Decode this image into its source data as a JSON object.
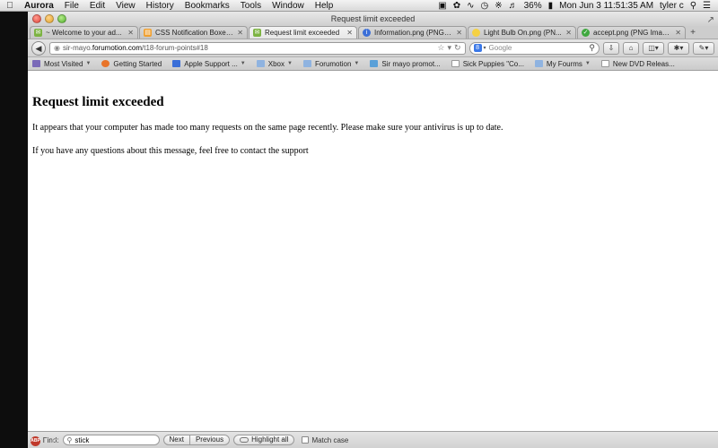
{
  "menubar": {
    "apple": "",
    "items": [
      "Aurora",
      "File",
      "Edit",
      "View",
      "History",
      "Bookmarks",
      "Tools",
      "Window",
      "Help"
    ],
    "battery": "36%",
    "clock": "Mon Jun 3  11:51:35 AM",
    "user": "tyler c"
  },
  "window": {
    "title": "Request limit exceeded"
  },
  "tabs": [
    {
      "label": "~ Welcome to your ad...",
      "icon": "speech-bubble-icon",
      "color": "#7cb342",
      "active": false
    },
    {
      "label": "CSS Notification Boxes ...",
      "icon": "folder-icon",
      "color": "#f0a030",
      "active": false
    },
    {
      "label": "Request limit exceeded",
      "icon": "speech-bubble-icon",
      "color": "#7cb342",
      "active": true
    },
    {
      "label": "Information.png (PNG I...",
      "icon": "info-icon",
      "color": "#3b6fd8",
      "active": false
    },
    {
      "label": "Light Bulb On.png (PN...",
      "icon": "lightbulb-icon",
      "color": "#f5d142",
      "active": false
    },
    {
      "label": "accept.png (PNG Image...",
      "icon": "check-icon",
      "color": "#3ea83e",
      "active": false
    }
  ],
  "nav": {
    "url_prefix": "sir-mayo.",
    "url_domain": "forumotion.com",
    "url_path": "/t18-forum-points#18",
    "search_placeholder": "Google",
    "search_engine": "8"
  },
  "bookmarks": [
    {
      "label": "Most Visited",
      "icon": "most-visited-icon",
      "color": "#7a6ab8",
      "dropdown": true
    },
    {
      "label": "Getting Started",
      "icon": "firefox-icon",
      "color": "#e8742a",
      "dropdown": false
    },
    {
      "label": "Apple Support ...",
      "icon": "apple-support-icon",
      "color": "#3b6fd8",
      "dropdown": true
    },
    {
      "label": "Xbox",
      "icon": "folder-icon",
      "color": "#8fb3e0",
      "dropdown": true
    },
    {
      "label": "Forumotion",
      "icon": "folder-icon",
      "color": "#8fb3e0",
      "dropdown": true
    },
    {
      "label": "Sir mayo promot...",
      "icon": "sir-mayo-icon",
      "color": "#5aa0d8",
      "dropdown": false
    },
    {
      "label": "Sick Puppies \"Co...",
      "icon": "page-icon",
      "color": "#ffffff",
      "dropdown": false
    },
    {
      "label": "My Fourms",
      "icon": "folder-icon",
      "color": "#8fb3e0",
      "dropdown": true
    },
    {
      "label": "New DVD Releas...",
      "icon": "page-icon",
      "color": "#ffffff",
      "dropdown": false
    }
  ],
  "page": {
    "heading": "Request limit exceeded",
    "paragraph1": "It appears that your computer has made too many requests on the same page recently. Please make sure your antivirus is up to date.",
    "paragraph2": "If you have any questions about this message, feel free to contact the support"
  },
  "findbar": {
    "label": "Find:",
    "value": "stick",
    "next": "Next",
    "previous": "Previous",
    "highlight_all": "Highlight all",
    "match_case": "Match case"
  },
  "statusbar": {
    "abp_label": "ABP"
  }
}
